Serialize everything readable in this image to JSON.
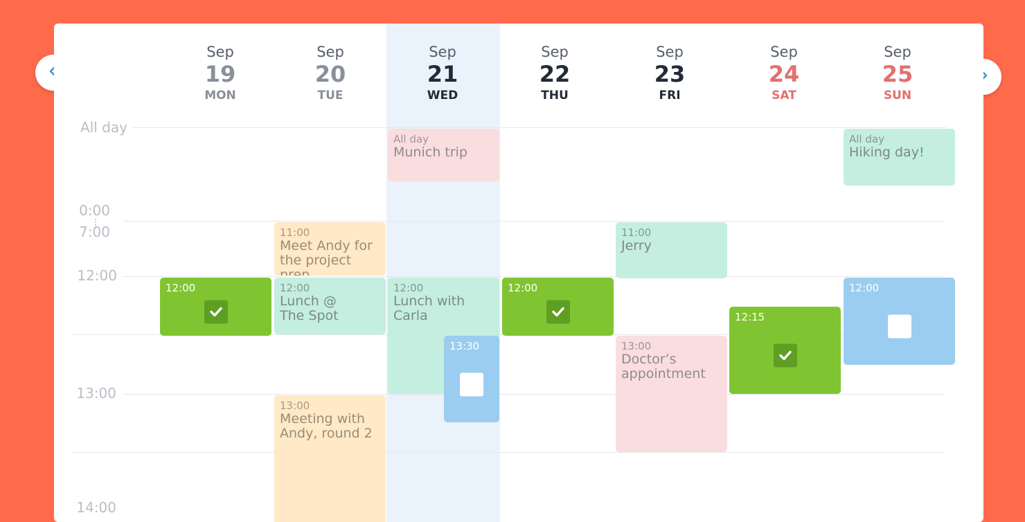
{
  "nav": {
    "prev_icon": "chevron-left-icon",
    "next_icon": "chevron-right-icon"
  },
  "days": [
    {
      "month": "Sep",
      "num": "19",
      "dow": "MON"
    },
    {
      "month": "Sep",
      "num": "20",
      "dow": "TUE"
    },
    {
      "month": "Sep",
      "num": "21",
      "dow": "WED"
    },
    {
      "month": "Sep",
      "num": "22",
      "dow": "THU"
    },
    {
      "month": "Sep",
      "num": "23",
      "dow": "FRI"
    },
    {
      "month": "Sep",
      "num": "24",
      "dow": "SAT"
    },
    {
      "month": "Sep",
      "num": "25",
      "dow": "SUN"
    }
  ],
  "time_labels": {
    "all_day": "All day",
    "t0": "0:00",
    "t7": "7:00",
    "t12": "12:00",
    "t13": "13:00",
    "t14": "14:00"
  },
  "events": {
    "munich": {
      "time": "All day",
      "title": "Munich trip"
    },
    "hiking": {
      "time": "All day",
      "title": "Hiking day!"
    },
    "meet_andy": {
      "time": "11:00",
      "title": "Meet Andy for the project prep"
    },
    "jerry": {
      "time": "11:00",
      "title": "Jerry"
    },
    "task_mon": {
      "time": "12:00",
      "done": true
    },
    "lunch_spot": {
      "time": "12:00",
      "title": "Lunch @\nThe Spot"
    },
    "lunch_carla": {
      "time": "12:00",
      "title": "Lunch with\nCarla"
    },
    "task_thu": {
      "time": "12:00",
      "done": true
    },
    "task_sun": {
      "time": "12:00",
      "done": false
    },
    "task_wed": {
      "time": "13:30",
      "done": false
    },
    "task_sat": {
      "time": "12:15",
      "done": true
    },
    "doctor": {
      "time": "13:00",
      "title": "Doctor’s\nappointment"
    },
    "meeting_andy2": {
      "time": "13:00",
      "title": "Meeting with\nAndy, round 2"
    }
  },
  "colors": {
    "background": "#FF6A4A",
    "today_highlight": "#EAF2FB",
    "weekend": "#e46f6f",
    "task_done": "#80C531",
    "task_open": "#9BCDF0"
  }
}
